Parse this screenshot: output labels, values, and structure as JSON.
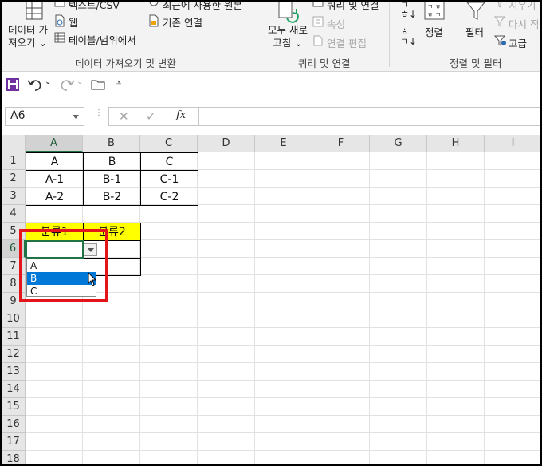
{
  "ribbon": {
    "get_data": {
      "line1": "데이터 가",
      "line2": "져오기 ⌄"
    },
    "text_csv": "텍스트/CSV",
    "web": "웹",
    "from_table": "테이블/범위에서",
    "recent_sources": "최근에 사용한 원본",
    "existing_conn": "기존 연결",
    "group_get_transform": "데이터 가져오기 및 변환",
    "refresh_all": {
      "line1": "모두 새로",
      "line2": "고침 ⌄"
    },
    "queries_conn": "쿼리 및 연결",
    "properties": "속성",
    "edit_links": "연결 편집",
    "group_queries": "쿼리 및 연결",
    "sort": "정렬",
    "filter": "필터",
    "clear": "지우기",
    "reapply": "다시 적",
    "advanced": "고급",
    "group_sort_filter": "정렬 및 필터"
  },
  "namebox": {
    "value": "A6"
  },
  "formula": {
    "cancel": "✕",
    "enter": "✓",
    "fx": "fx",
    "content": ""
  },
  "grid": {
    "columns": [
      "A",
      "B",
      "C",
      "D",
      "E",
      "F",
      "G",
      "H",
      "I"
    ],
    "rows": [
      "1",
      "2",
      "3",
      "4",
      "5",
      "6",
      "7",
      "8",
      "9",
      "10",
      "11",
      "12",
      "13",
      "14",
      "15",
      "16",
      "17",
      "18"
    ],
    "cells": {
      "A1": "A",
      "B1": "B",
      "C1": "C",
      "A2": "A-1",
      "B2": "B-1",
      "C2": "C-1",
      "A3": "A-2",
      "B3": "B-2",
      "C3": "C-2",
      "A5": "분류1",
      "B5": "분류2"
    }
  },
  "dropdown": {
    "options": [
      "A",
      "B",
      "C"
    ],
    "highlighted": "B"
  },
  "colors": {
    "accent": "#217346",
    "highlight": "#0078d7",
    "header_fill": "#ffff00",
    "annotation": "#e4141b"
  }
}
